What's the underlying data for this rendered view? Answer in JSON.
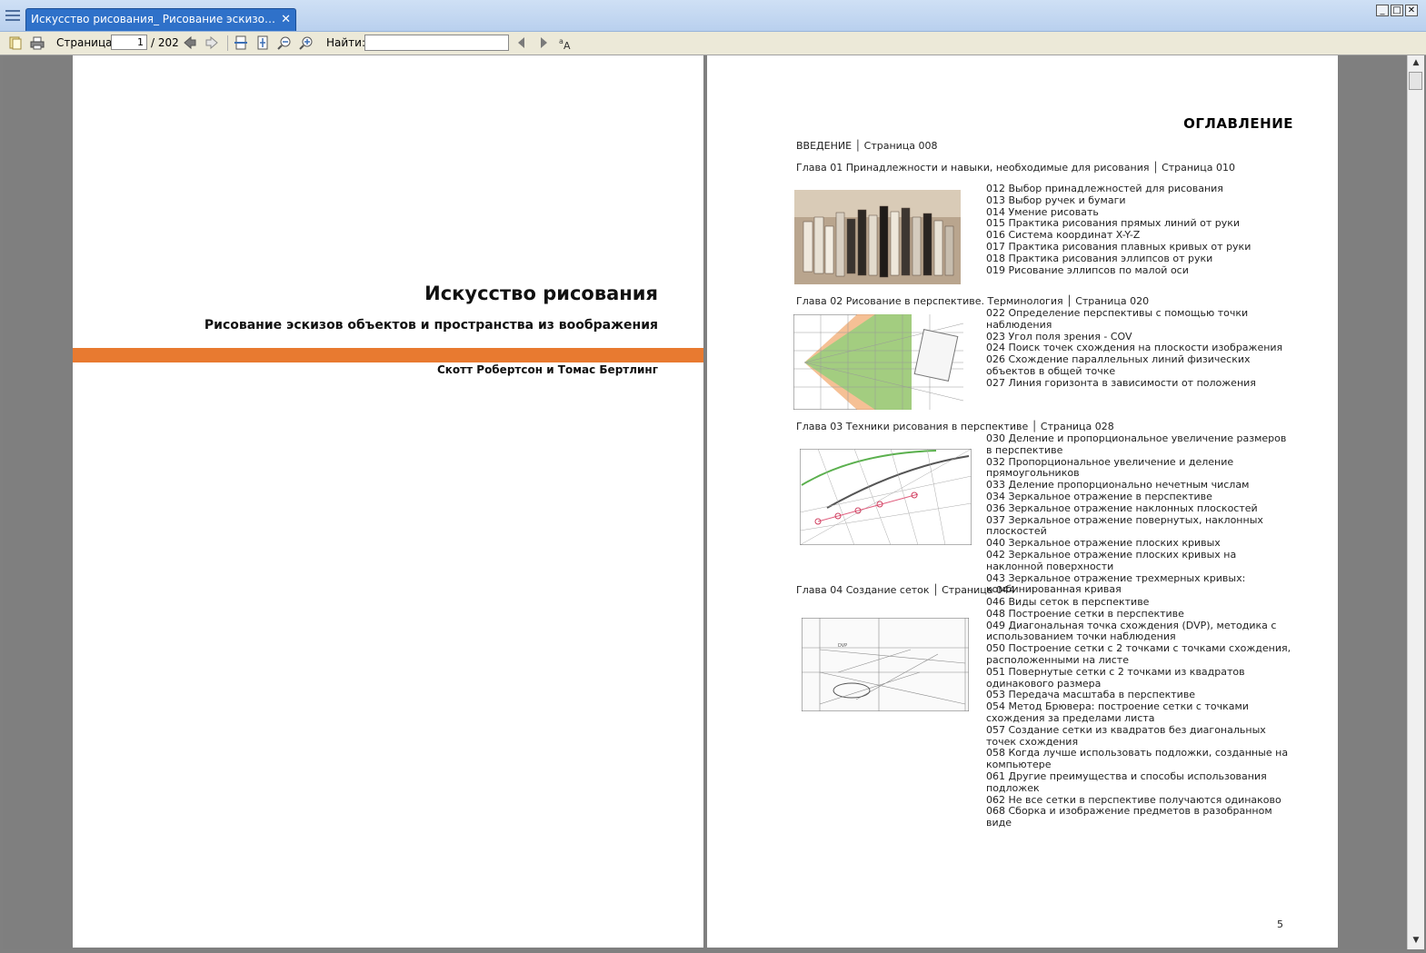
{
  "window": {
    "tab_title": "Искусство рисования_ Рисование эскизов объекто...",
    "tab_close": "✕",
    "minimize": "_",
    "maximize": "□",
    "close": "✕"
  },
  "toolbar": {
    "page_label": "Страница:",
    "page_current": "1",
    "page_total": "/ 202",
    "find_label": "Найти:",
    "find_value": "",
    "icons": [
      "open-icon",
      "print-icon",
      "prev-page-icon",
      "next-page-icon",
      "fit-width-icon",
      "fit-page-icon",
      "zoom-out-icon",
      "zoom-in-icon",
      "find-prev-icon",
      "find-next-icon",
      "match-case-icon"
    ]
  },
  "left_page": {
    "title": "Искусство рисования",
    "subtitle": "Рисование эскизов объектов и пространства из воображения",
    "authors": "Скотт Робертсон и Томас Бертлинг",
    "accent_color": "#e87a30"
  },
  "right_page": {
    "heading": "ОГЛАВЛЕНИЕ",
    "intro": "ВВЕДЕНИЕ │ Страница 008",
    "page_number": "5",
    "chapters": [
      {
        "title": "Глава 01 Принадлежности и навыки, необходимые для рисования │ Страница 010",
        "items": [
          "012 Выбор принадлежностей для рисования",
          "013 Выбор ручек и бумаги",
          "014 Умение рисовать",
          "015 Практика рисования прямых линий от руки",
          "016 Система координат X-Y-Z",
          "017 Практика рисования плавных кривых от руки",
          "018 Практика рисования эллипсов от руки",
          "019 Рисование эллипсов по малой оси"
        ]
      },
      {
        "title": "Глава 02 Рисование в перспективе. Терминология │ Страница 020",
        "items": [
          "022 Определение перспективы с помощью точки наблюдения",
          "023 Угол поля зрения - COV",
          "024 Поиск точек схождения на плоскости изображения",
          "026 Схождение параллельных линий физических объектов в общей точке",
          "027 Линия горизонта в зависимости от положения"
        ]
      },
      {
        "title": "Глава 03 Техники рисования в перспективе │ Страница 028",
        "items": [
          "030 Деление и пропорциональное увеличение размеров в перспективе",
          "032 Пропорциональное увеличение и деление прямоугольников",
          "033 Деление пропорционально нечетным числам",
          "034 Зеркальное отражение в перспективе",
          "036 Зеркальное отражение наклонных плоскостей",
          "037 Зеркальное отражение повернутых, наклонных плоскостей",
          "040 Зеркальное отражение плоских кривых",
          "042 Зеркальное отражение плоских кривых на наклонной поверхности",
          "043 Зеркальное отражение трехмерных кривых: комбинированная кривая"
        ]
      },
      {
        "title": "Глава 04 Создание сеток │ Страница 044",
        "items": [
          "046 Виды сеток в перспективе",
          "048 Построение сетки в перспективе",
          "049 Диагональная точка схождения (DVP), методика с использованием точки наблюдения",
          "050 Построение сетки с 2 точками с точками схождения, расположенными на листе",
          "051 Повернутые сетки с 2 точками из квадратов одинакового размера",
          "053 Передача масштаба в перспективе",
          "054 Метод Брювера: построение сетки с точками схождения за пределами листа",
          "057 Создание сетки из квадратов без диагональных точек схождения",
          "058 Когда лучше использовать подложки, созданные на компьютере",
          "061 Другие преимущества и способы использования подложек",
          "062 Не все сетки в перспективе получаются одинаково",
          "068 Сборка и изображение предметов в разобранном виде"
        ]
      }
    ]
  }
}
